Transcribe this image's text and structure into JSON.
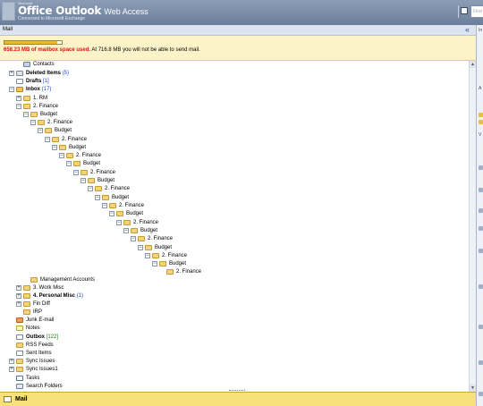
{
  "header": {
    "brand_small": "Microsoft",
    "app_name": "Office Outlook",
    "app_suffix": "Web Access",
    "subtitle": "Connected to Microsoft Exchange",
    "user_glyph": " ",
    "find_placeholder": "Find"
  },
  "nav": {
    "title": "Mail",
    "collapse_glyph": "«"
  },
  "quota": {
    "fill_fraction": 0.92,
    "used": "658.23 MB of mailbox space used.",
    "warning": " At 716.8 MB you will not be able to send mail."
  },
  "tree": [
    {
      "label": "Contacts",
      "icon": "contacts",
      "expander": "",
      "count": "",
      "bold": false
    },
    {
      "label": "Deleted Items",
      "icon": "deleted",
      "expander": "+",
      "count": "(5)",
      "bold": true
    },
    {
      "label": "Drafts",
      "icon": "drafts",
      "expander": "",
      "count": "[1]",
      "bold": true
    },
    {
      "label": "Inbox",
      "icon": "inbox",
      "expander": "−",
      "count": "(17)",
      "bold": true
    },
    {
      "label": "1. RM",
      "icon": "folder",
      "expander": "+",
      "count": "",
      "bold": false
    },
    {
      "label": "2. Finance",
      "icon": "folder",
      "expander": "−",
      "count": "",
      "bold": false
    },
    {
      "label": "Budget",
      "icon": "folder",
      "expander": "−",
      "count": "",
      "bold": false
    },
    {
      "label": "2. Finance",
      "icon": "folder",
      "expander": "−",
      "count": "",
      "bold": false
    },
    {
      "label": "Budget",
      "icon": "folder",
      "expander": "−",
      "count": "",
      "bold": false
    },
    {
      "label": "2. Finance",
      "icon": "folder",
      "expander": "−",
      "count": "",
      "bold": false
    },
    {
      "label": "Budget",
      "icon": "folder",
      "expander": "−",
      "count": "",
      "bold": false
    },
    {
      "label": "2. Finance",
      "icon": "folder",
      "expander": "−",
      "count": "",
      "bold": false
    },
    {
      "label": "Budget",
      "icon": "folder",
      "expander": "−",
      "count": "",
      "bold": false
    },
    {
      "label": "2. Finance",
      "icon": "folder",
      "expander": "−",
      "count": "",
      "bold": false
    },
    {
      "label": "Budget",
      "icon": "folder",
      "expander": "−",
      "count": "",
      "bold": false
    },
    {
      "label": "2. Finance",
      "icon": "folder",
      "expander": "−",
      "count": "",
      "bold": false
    },
    {
      "label": "Budget",
      "icon": "folder",
      "expander": "−",
      "count": "",
      "bold": false
    },
    {
      "label": "2. Finance",
      "icon": "folder",
      "expander": "−",
      "count": "",
      "bold": false
    },
    {
      "label": "Budget",
      "icon": "folder",
      "expander": "−",
      "count": "",
      "bold": false
    },
    {
      "label": "2. Finance",
      "icon": "folder",
      "expander": "−",
      "count": "",
      "bold": false
    },
    {
      "label": "Budget",
      "icon": "folder",
      "expander": "−",
      "count": "",
      "bold": false
    },
    {
      "label": "2. Finance",
      "icon": "folder",
      "expander": "−",
      "count": "",
      "bold": false
    },
    {
      "label": "Budget",
      "icon": "folder",
      "expander": "−",
      "count": "",
      "bold": false
    },
    {
      "label": "2. Finance",
      "icon": "folder",
      "expander": "−",
      "count": "",
      "bold": false
    },
    {
      "label": "Budget",
      "icon": "folder",
      "expander": "−",
      "count": "",
      "bold": false
    },
    {
      "label": "2. Finance",
      "icon": "folder",
      "expander": "",
      "count": "",
      "bold": false
    },
    {
      "label": "Management Accounts",
      "icon": "folder",
      "expander": "",
      "count": "",
      "bold": false
    },
    {
      "label": "3. Work Misc",
      "icon": "folder",
      "expander": "+",
      "count": "",
      "bold": false
    },
    {
      "label": "4. Personal Misc",
      "icon": "folder",
      "expander": "+",
      "count": "(1)",
      "bold": true
    },
    {
      "label": "Fin Diff",
      "icon": "folder",
      "expander": "+",
      "count": "",
      "bold": false
    },
    {
      "label": "IRP",
      "icon": "folder",
      "expander": "",
      "count": "",
      "bold": false
    },
    {
      "label": "Junk E-mail",
      "icon": "junk",
      "expander": "",
      "count": "",
      "bold": false
    },
    {
      "label": "Notes",
      "icon": "notes",
      "expander": "",
      "count": "",
      "bold": false
    },
    {
      "label": "Outbox",
      "icon": "outbox",
      "expander": "",
      "count": "[122]",
      "bold": true
    },
    {
      "label": "RSS Feeds",
      "icon": "folder",
      "expander": "",
      "count": "",
      "bold": false
    },
    {
      "label": "Sent Items",
      "icon": "sent",
      "expander": "",
      "count": "",
      "bold": false
    },
    {
      "label": "Sync Issues",
      "icon": "folder",
      "expander": "+",
      "count": "",
      "bold": false
    },
    {
      "label": "Sync Issues1",
      "icon": "folder",
      "expander": "+",
      "count": "",
      "bold": false
    },
    {
      "label": "Tasks",
      "icon": "tasks",
      "expander": "",
      "count": "",
      "bold": false
    },
    {
      "label": "Search Folders",
      "icon": "search",
      "expander": "",
      "count": "",
      "bold": false
    }
  ],
  "bottom": {
    "mail_label": "Mail"
  },
  "right_pane": {
    "label_a": "In",
    "label_b": "A",
    "label_c": "V"
  },
  "colors": {
    "header": "#7a8da9",
    "quota_bg": "#fcf3c9",
    "quota_used": "#dd1111",
    "unread_count": "#2546c4",
    "outbox_count": "#1b7d1b",
    "bottom_bar": "#f8e07a"
  }
}
